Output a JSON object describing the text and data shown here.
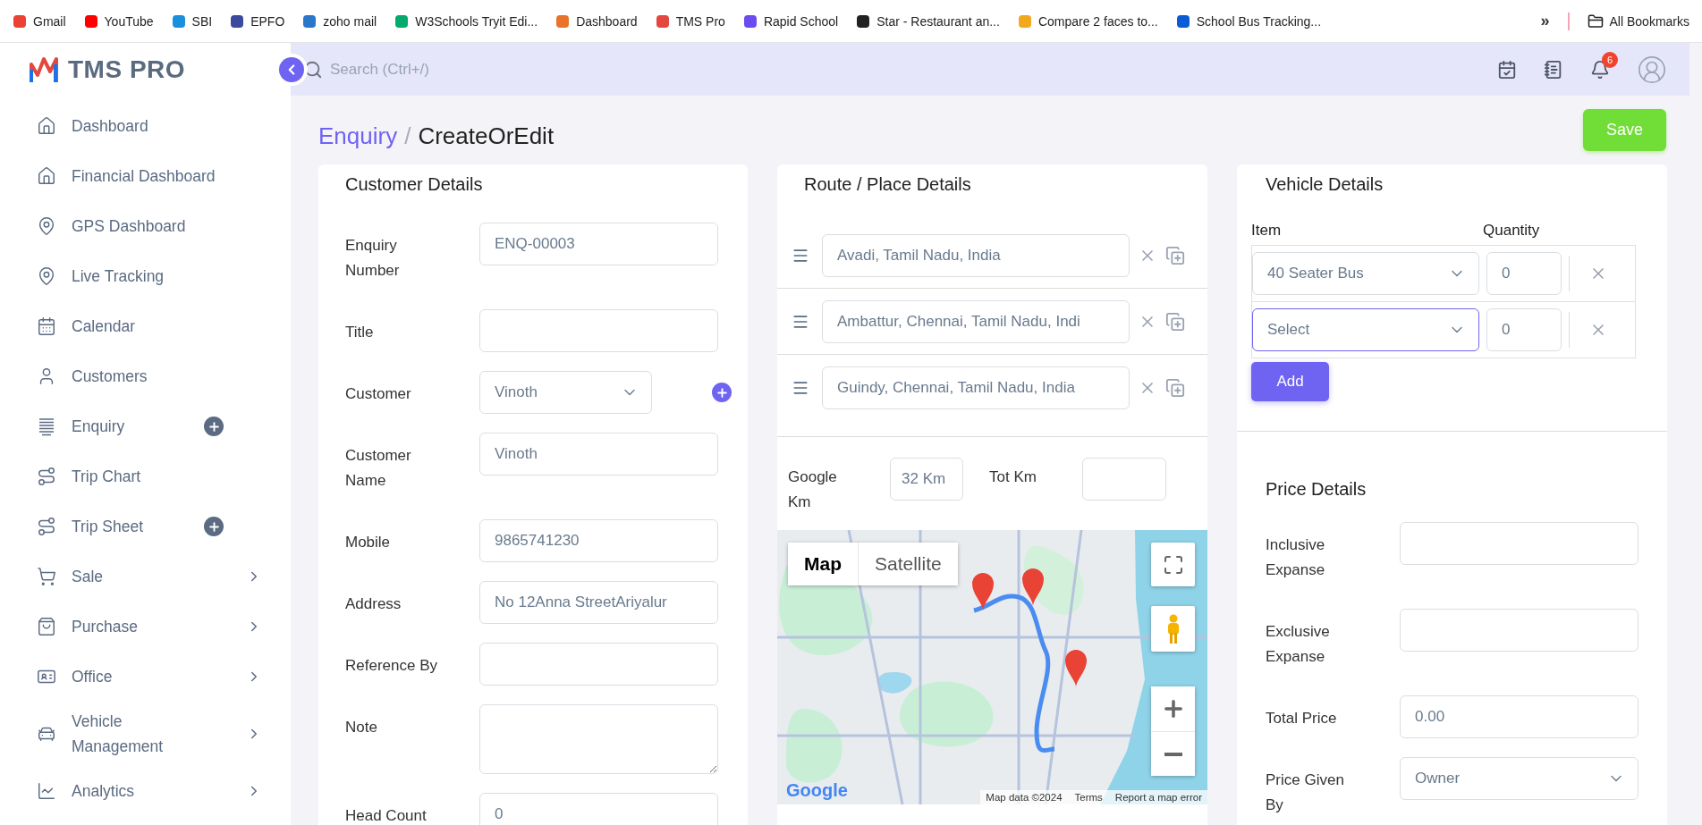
{
  "bookmarks": [
    {
      "label": "Gmail",
      "color": "#ea4335"
    },
    {
      "label": "YouTube",
      "color": "#ff0000"
    },
    {
      "label": "SBI",
      "color": "#1a8fdd"
    },
    {
      "label": "EPFO",
      "color": "#3b4a9c"
    },
    {
      "label": "zoho mail",
      "color": "#2a77c9"
    },
    {
      "label": "W3Schools Tryit Edi...",
      "color": "#04aa6d"
    },
    {
      "label": "Dashboard",
      "color": "#e8732a"
    },
    {
      "label": "TMS Pro",
      "color": "#e4473d"
    },
    {
      "label": "Rapid School",
      "color": "#6c4bf0"
    },
    {
      "label": "Star - Restaurant an...",
      "color": "#222222"
    },
    {
      "label": "Compare 2 faces to...",
      "color": "#f2a81d"
    },
    {
      "label": "School Bus Tracking...",
      "color": "#0a5bd6"
    }
  ],
  "bookmarks_more": "»",
  "all_bookmarks": "All Bookmarks",
  "brand": "TMS PRO",
  "search": {
    "placeholder": "Search (Ctrl+/)"
  },
  "notifications": {
    "count": "6"
  },
  "sidebar": {
    "items": [
      {
        "label": "Dashboard",
        "kind": "plain"
      },
      {
        "label": "Financial Dashboard",
        "kind": "plain"
      },
      {
        "label": "GPS Dashboard",
        "kind": "plain"
      },
      {
        "label": "Live Tracking",
        "kind": "plain"
      },
      {
        "label": "Calendar",
        "kind": "plain"
      },
      {
        "label": "Customers",
        "kind": "plain"
      },
      {
        "label": "Enquiry",
        "kind": "add"
      },
      {
        "label": "Trip Chart",
        "kind": "plain"
      },
      {
        "label": "Trip Sheet",
        "kind": "add"
      },
      {
        "label": "Sale",
        "kind": "submenu"
      },
      {
        "label": "Purchase",
        "kind": "submenu"
      },
      {
        "label": "Office",
        "kind": "submenu"
      },
      {
        "label": "Vehicle Management",
        "kind": "submenu"
      },
      {
        "label": "Analytics",
        "kind": "submenu"
      }
    ]
  },
  "breadcrumb": {
    "parent": "Enquiry",
    "separator": "/",
    "current": "CreateOrEdit"
  },
  "save_button": "Save",
  "customer_details": {
    "title": "Customer Details",
    "fields": [
      {
        "label": "Enquiry Number",
        "value": "ENQ-00003",
        "kind": "text"
      },
      {
        "label": "Title",
        "kind": "text"
      },
      {
        "label": "Customer",
        "value": "Vinoth",
        "kind": "select"
      },
      {
        "label": "Customer Name",
        "value": "Vinoth",
        "kind": "text"
      },
      {
        "label": "Mobile",
        "value": "9865741230",
        "kind": "text"
      },
      {
        "label": "Address",
        "value": "No 12Anna StreetAriyalur",
        "kind": "text"
      },
      {
        "label": "Reference By",
        "kind": "text"
      },
      {
        "label": "Note",
        "kind": "textarea"
      },
      {
        "label": "Head Count",
        "value": "0",
        "kind": "text"
      }
    ]
  },
  "route": {
    "title": "Route / Place Details",
    "places": [
      {
        "value": "Avadi, Tamil Nadu, India"
      },
      {
        "value": "Ambattur, Chennai, Tamil Nadu, Indi"
      },
      {
        "value": "Guindy, Chennai, Tamil Nadu, India"
      }
    ],
    "google_km": {
      "label": "Google Km",
      "value": "32 Km"
    },
    "tot_km": {
      "label": "Tot Km"
    },
    "map": {
      "kind": "picture",
      "map_types": [
        {
          "label": "Map",
          "selected": true
        },
        {
          "label": "Satellite",
          "selected": false
        }
      ],
      "logo": "Google",
      "attribution": "Map data ©2024",
      "terms": "Terms",
      "report": "Report a map error"
    }
  },
  "vehicle": {
    "title": "Vehicle Details",
    "columns": [
      "Item",
      "Quantity"
    ],
    "rows": [
      {
        "item": "40 Seater Bus",
        "quantity": "0",
        "focused": false
      },
      {
        "placeholder": "Select",
        "quantity": "0",
        "focused": true
      }
    ],
    "add_button": "Add"
  },
  "price": {
    "title": "Price Details",
    "fields": [
      {
        "label": "Inclusive Expanse",
        "kind": "text"
      },
      {
        "label": "Exclusive Expanse",
        "kind": "text"
      },
      {
        "label": "Total Price",
        "value": "0.00",
        "kind": "text"
      },
      {
        "label": "Price Given By",
        "value": "Owner",
        "kind": "select"
      }
    ]
  }
}
